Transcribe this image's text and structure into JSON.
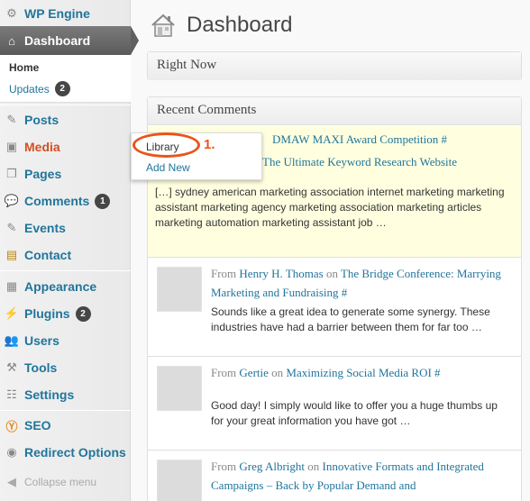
{
  "sidebar": {
    "site_name": "WP Engine",
    "dashboard": "Dashboard",
    "submenu": {
      "home": "Home",
      "updates": "Updates",
      "updates_count": "2"
    },
    "items": [
      {
        "label": "Posts",
        "icon": "pin-icon"
      },
      {
        "label": "Media",
        "icon": "media-icon"
      },
      {
        "label": "Pages",
        "icon": "pages-icon"
      },
      {
        "label": "Comments",
        "icon": "comments-icon",
        "badge": "1"
      },
      {
        "label": "Events",
        "icon": "pin-icon"
      },
      {
        "label": "Contact",
        "icon": "contact-icon"
      },
      {
        "label": "Appearance",
        "icon": "appearance-icon"
      },
      {
        "label": "Plugins",
        "icon": "plugins-icon",
        "badge": "2"
      },
      {
        "label": "Users",
        "icon": "users-icon"
      },
      {
        "label": "Tools",
        "icon": "tools-icon"
      },
      {
        "label": "Settings",
        "icon": "settings-icon"
      },
      {
        "label": "SEO",
        "icon": "seo-icon"
      },
      {
        "label": "Redirect Options",
        "icon": "redirect-icon"
      }
    ],
    "collapse": "Collapse menu"
  },
  "flyout": {
    "library": "Library",
    "add_new": "Add New",
    "step": "1."
  },
  "main": {
    "title": "Dashboard",
    "right_now": "Right Now",
    "recent_comments": "Recent Comments",
    "comments": [
      {
        "post_partial": "DMAW MAXI Award Competition #",
        "sub_partial": "The Ultimate Keyword Research Website",
        "excerpt": "[…] sydney american marketing association internet marketing marketing assistant marketing agency marketing association marketing articles marketing automation marketing assistant job …"
      },
      {
        "from": "From",
        "author": "Henry H. Thomas",
        "on": "on",
        "post": "The Bridge Conference: Marrying Marketing and Fundraising #",
        "excerpt": "Sounds like a great idea to generate some synergy. These industries have had a barrier between them for far too …"
      },
      {
        "from": "From",
        "author": "Gertie",
        "on": "on",
        "post": "Maximizing Social Media ROI #",
        "excerpt": "Good day! I simply would like to offer you a huge thumbs up for your great information you have got …"
      },
      {
        "from": "From",
        "author": "Greg Albright",
        "on": "on",
        "post": "Innovative Formats and Integrated Campaigns – Back by Popular Demand and",
        "excerpt": ""
      }
    ]
  },
  "colors": {
    "link": "#21759b",
    "active_media": "#d54e21",
    "annotation": "#e8541d",
    "highlight_row": "#ffffe0"
  }
}
